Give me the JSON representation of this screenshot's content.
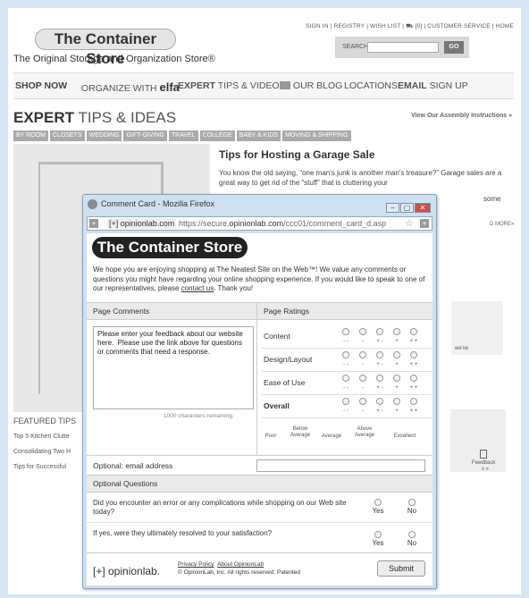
{
  "site": {
    "logo": "The Container Store",
    "tagline": "The Original Storage and Organization Store®",
    "toplinks": "SIGN IN | REGISTRY | WISH LIST | ⛟ [0] | CUSTOMER SERVICE | HOME",
    "search_label": "SEARCH",
    "go_label": "GO"
  },
  "nav": {
    "shop_now": "SHOP NOW",
    "organize": "ORGANIZE WITH",
    "elfa": "elfa",
    "expert": "EXPERT",
    "tips_videos": "TIPS & VIDEOS",
    "blog": "OUR BLOG",
    "locations": "LOCATIONS",
    "email": "EMAIL",
    "signup": "SIGN UP"
  },
  "expert_heading": {
    "bold": "EXPERT",
    "rest": "TIPS & IDEAS"
  },
  "assembly_link": "View Our Assembly Instructions »",
  "tabs": [
    "BY ROOM",
    "CLOSETS",
    "WEDDING",
    "GIFT-GIVING",
    "TRAVEL",
    "COLLEGE",
    "BABY & KIDS",
    "MOVING & SHIPPING"
  ],
  "article": {
    "title": "Tips for Hosting a Garage Sale",
    "body": "You know the old saying, “one man's junk is another man's treasure?” Garage sales are a great way to get rid of the “stuff” that is cluttering your",
    "tail": "some",
    "more": "D MORE»"
  },
  "featured": {
    "heading": "FEATURED TIPS",
    "items": [
      "Top 5 Kitchen Clutte",
      "Consolidating Two H",
      "Tips for Successful"
    ],
    "weve": "we've",
    "more_right": "s »"
  },
  "feedback_label": "Feedback",
  "popup": {
    "window_title": "Comment Card - Mozilla Firefox",
    "domain": "opinionlab.com",
    "url_prefix": "https://secure.",
    "url_host": "opinionlab.com",
    "url_path": "/ccc01/comment_card_d.asp",
    "logo": "The Container Store",
    "intro_1": "We hope you are enjoying shopping at The Neatest Site on the Web™! We value any comments or questions you might have regarding your online shopping experience. If you would like to speak to one of our representatives, please ",
    "intro_link": "contact us",
    "intro_2": ". Thank you!",
    "page_comments": "Page Comments",
    "page_ratings": "Page Ratings",
    "comment_text": "Please enter your feedback about our website here.  Please use the link above for questions or comments that need a response.",
    "chars_remaining": "1000 characters remaining.",
    "rating_rows": [
      "Content",
      "Design/Layout",
      "Ease of Use",
      "Overall"
    ],
    "rating_symbols": [
      "- -",
      "-",
      "+ -",
      "+",
      "+ +"
    ],
    "scale": {
      "poor": "Poor",
      "below": "Below Average",
      "average": "Average",
      "above": "Above Average",
      "excellent": "Excellent"
    },
    "email_label": "Optional: email address",
    "optional_questions": "Optional Questions",
    "q1": "Did you encounter an error or any complications while shopping on our Web site today?",
    "q2": "If yes, were they ultimately resolved to your satisfaction?",
    "yes": "Yes",
    "no": "No",
    "footer_logo": "[+] opinionlab.",
    "privacy": "Privacy Policy",
    "about": "About OpinionLab",
    "copyright": "© OpinionLab, Inc. All rights reserved; Patented",
    "submit": "Submit"
  }
}
